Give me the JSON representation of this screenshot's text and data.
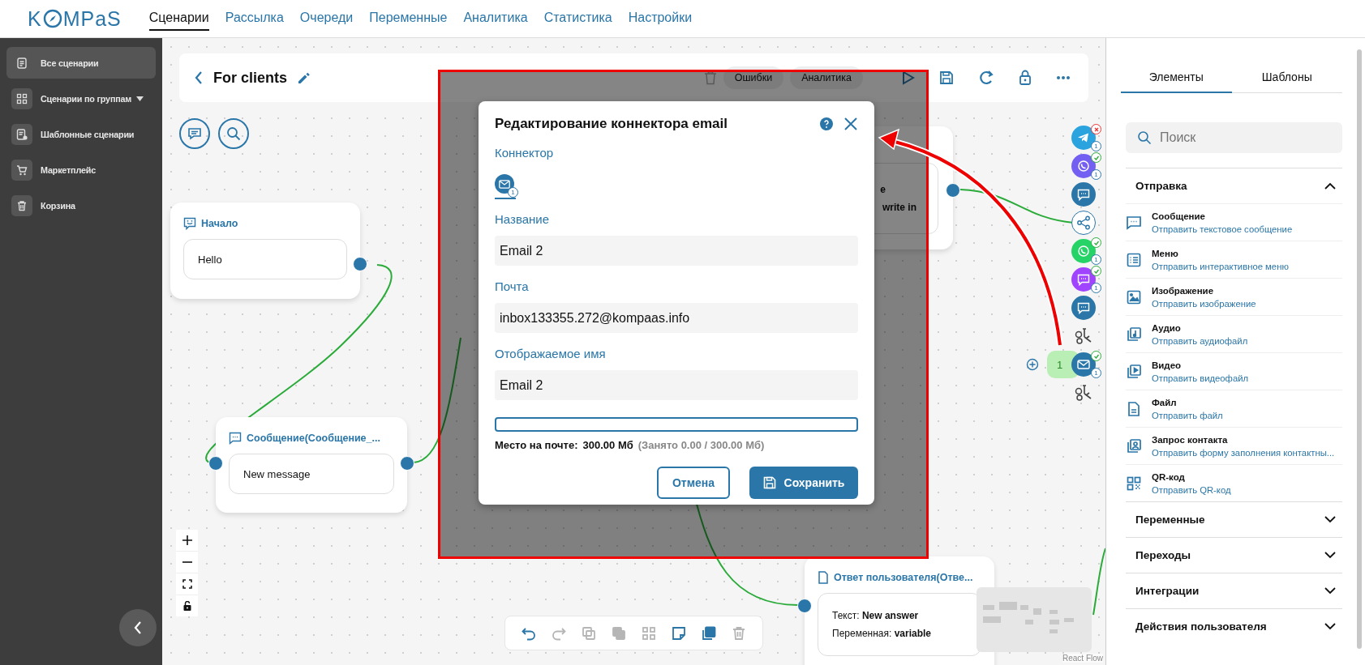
{
  "logo": {
    "prefix": "K",
    "suffix": "MPaS"
  },
  "nav": [
    {
      "label": "Сценарии",
      "selected": true
    },
    {
      "label": "Рассылка",
      "selected": false
    },
    {
      "label": "Очереди",
      "selected": false
    },
    {
      "label": "Переменные",
      "selected": false
    },
    {
      "label": "Аналитика",
      "selected": false
    },
    {
      "label": "Статистика",
      "selected": false
    },
    {
      "label": "Настройки",
      "selected": false
    }
  ],
  "sidebar": {
    "items": [
      {
        "label": "Все сценарии",
        "selected": true,
        "has_menu": false
      },
      {
        "label": "Сценарии по группам",
        "selected": false,
        "has_menu": true
      },
      {
        "label": "Шаблонные сценарии",
        "selected": false,
        "has_menu": false
      },
      {
        "label": "Маркетплейс",
        "selected": false,
        "has_menu": false
      },
      {
        "label": "Корзина",
        "selected": false,
        "has_menu": false
      }
    ]
  },
  "scenario": {
    "title": "For clients",
    "pills": [
      "Ошибки",
      "Аналитика"
    ]
  },
  "nodes": [
    {
      "kind": "start",
      "title": "Начало",
      "text": "Hello"
    },
    {
      "kind": "message",
      "title": "Сообщение(Сообщение_...",
      "text": "New message"
    },
    {
      "kind": "partial",
      "lines": [
        "e",
        "write in"
      ]
    },
    {
      "kind": "answer",
      "title": "Ответ пользователя(Отве...",
      "lines": [
        {
          "label": "Текст:",
          "value": "New answer"
        },
        {
          "label": "Переменная:",
          "value": "variable"
        }
      ]
    }
  ],
  "channels": [
    {
      "kind": "telegram",
      "color": "#2aa3df",
      "badge": {
        "connected": false,
        "count": "1"
      }
    },
    {
      "kind": "viber",
      "color": "#7360f2",
      "badge": {
        "connected": true,
        "count": "1"
      }
    },
    {
      "kind": "chat",
      "color": "#2a76a8"
    },
    {
      "kind": "share",
      "color": "#ffffff"
    },
    {
      "kind": "whatsapp",
      "color": "#25d366",
      "badge": {
        "connected": true,
        "count": "1"
      }
    },
    {
      "kind": "messenger",
      "color": "#a044ff",
      "badge": {
        "connected": true,
        "count": "1"
      }
    },
    {
      "kind": "sms",
      "color": "#2a76a8"
    },
    {
      "kind": "tools"
    },
    {
      "kind": "mail",
      "color": "#2a76a8",
      "badge": {
        "connected": true,
        "count": "1"
      },
      "bubble": "1"
    },
    {
      "kind": "tools"
    }
  ],
  "toolbar": [
    {
      "disabled": false
    },
    {
      "disabled": true
    },
    {
      "disabled": true
    },
    {
      "disabled": true
    },
    {
      "disabled": true
    },
    {
      "disabled": false
    },
    {
      "disabled": false
    },
    {
      "disabled": true
    }
  ],
  "attribution": "React Flow",
  "modal": {
    "title": "Редактирование коннектора email",
    "connector_label": "Коннектор",
    "connector": {
      "count": "1",
      "selected": true
    },
    "fields": [
      {
        "label": "Название",
        "value": "Email 2"
      },
      {
        "label": "Почта",
        "value": "inbox133355.272@kompaas.info"
      },
      {
        "label": "Отображаемое имя",
        "value": "Email 2"
      }
    ],
    "storage": {
      "level": 0,
      "label": "Место на почте:",
      "total": "300.00 Мб",
      "used": "(Занято 0.00 / 300.00 Мб)"
    },
    "cancel": "Отмена",
    "save": "Сохранить"
  },
  "panel": {
    "tabs": [
      {
        "label": "Элементы",
        "selected": true
      },
      {
        "label": "Шаблоны",
        "selected": false
      }
    ],
    "search": {
      "placeholder": "Поиск"
    },
    "sections": [
      {
        "title": "Отправка",
        "expanded": true,
        "items": [
          {
            "title": "Сообщение",
            "subtitle": "Отправить текстовое сообщение"
          },
          {
            "title": "Меню",
            "subtitle": "Отправить интерактивное меню"
          },
          {
            "title": "Изображение",
            "subtitle": "Отправить изображение"
          },
          {
            "title": "Аудио",
            "subtitle": "Отправить аудиофайл"
          },
          {
            "title": "Видео",
            "subtitle": "Отправить видеофайл"
          },
          {
            "title": "Файл",
            "subtitle": "Отправить файл"
          },
          {
            "title": "Запрос контакта",
            "subtitle": "Отправить форму заполнения контактны..."
          },
          {
            "title": "QR-код",
            "subtitle": "Отправить QR-код"
          }
        ]
      },
      {
        "title": "Переменные",
        "expanded": false
      },
      {
        "title": "Переходы",
        "expanded": false
      },
      {
        "title": "Интеграции",
        "expanded": false
      },
      {
        "title": "Действия пользователя",
        "expanded": false
      }
    ]
  }
}
